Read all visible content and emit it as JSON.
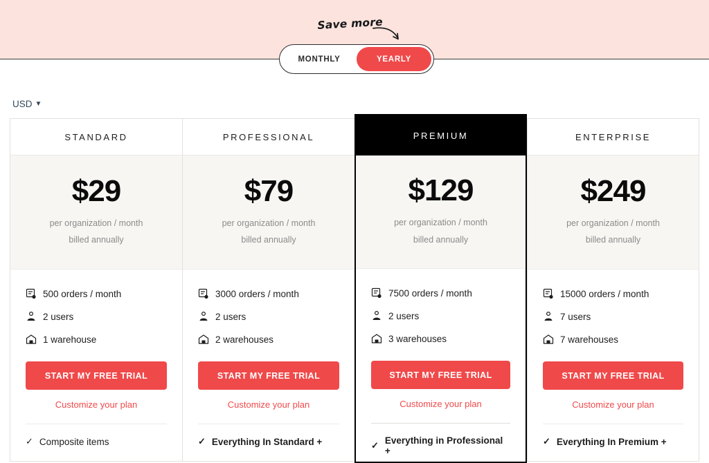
{
  "banner": {
    "save_more_label": "Save more",
    "arrow_icon": "curved-arrow-down-right-icon",
    "background_color": "#FCE3DD"
  },
  "billing_toggle": {
    "options": [
      {
        "label": "MONTHLY",
        "active": false
      },
      {
        "label": "YEARLY",
        "active": true
      }
    ],
    "active_color": "#F0494A"
  },
  "currency": {
    "label": "USD",
    "caret_icon": "chevron-down-icon"
  },
  "common": {
    "price_period": "per organization / month",
    "billing_note": "billed annually",
    "cta_label": "START MY FREE TRIAL",
    "customize_label": "Customize your plan",
    "check_icon": "check-icon",
    "orders_icon": "orders-document-icon",
    "users_icon": "user-icon",
    "warehouse_icon": "warehouse-icon",
    "accent_color": "#F0494A"
  },
  "plans": [
    {
      "name": "STANDARD",
      "price": "$29",
      "featured": false,
      "orders": "500 orders / month",
      "users": "2 users",
      "warehouses": "1 warehouse",
      "included_label": "Composite items",
      "included_bold": false
    },
    {
      "name": "PROFESSIONAL",
      "price": "$79",
      "featured": false,
      "orders": "3000 orders / month",
      "users": "2 users",
      "warehouses": "2 warehouses",
      "included_label": "Everything In Standard +",
      "included_bold": true
    },
    {
      "name": "PREMIUM",
      "price": "$129",
      "featured": true,
      "orders": "7500 orders / month",
      "users": "2 users",
      "warehouses": "3 warehouses",
      "included_label": "Everything in Professional +",
      "included_bold": true
    },
    {
      "name": "ENTERPRISE",
      "price": "$249",
      "featured": false,
      "orders": "15000 orders / month",
      "users": "7 users",
      "warehouses": "7 warehouses",
      "included_label": "Everything In Premium +",
      "included_bold": true
    }
  ]
}
